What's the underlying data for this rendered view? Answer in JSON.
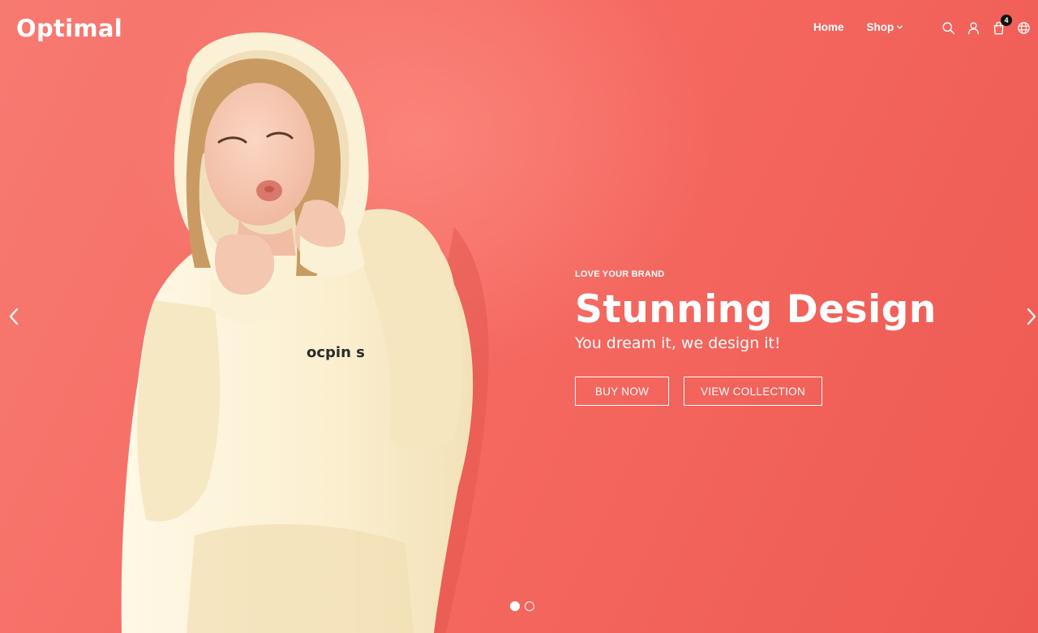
{
  "brand": {
    "name": "Optimal"
  },
  "nav": {
    "home_label": "Home",
    "shop_label": "Shop"
  },
  "header_icons": [
    "search-icon",
    "user-icon",
    "cart-icon",
    "globe-icon"
  ],
  "cart": {
    "count": "4"
  },
  "slide": {
    "eyebrow": "LOVE YOUR BRAND",
    "headline": "Stunning Design",
    "subheadline": "You dream it, we design it!",
    "buy_label": "BUY NOW",
    "view_label": "VIEW COLLECTION",
    "hoodie_print": "ocpin s"
  },
  "carousel": {
    "slide_count": 2,
    "active_index": 0
  },
  "colors": {
    "background": "#f2645c",
    "text": "#ffffff",
    "hoodie": "#fbf0d2",
    "badge": "#111111"
  }
}
